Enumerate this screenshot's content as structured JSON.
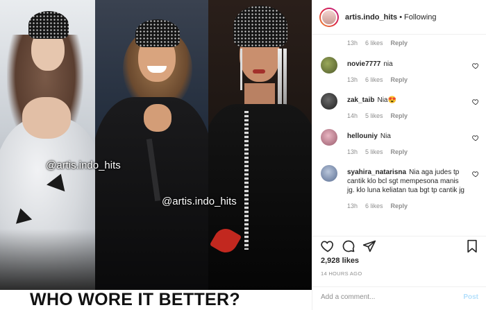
{
  "post": {
    "watermarks": [
      "@artis.indo_hits",
      "@artis.indo_hits"
    ],
    "caption": "WHO WORE IT BETTER?"
  },
  "header": {
    "username": "artis.indo_hits",
    "separator": "•",
    "follow_status": "Following"
  },
  "top_meta": {
    "time": "13h",
    "likes": "6 likes",
    "reply": "Reply"
  },
  "comments": [
    {
      "username": "novie7777",
      "text": "nia",
      "time": "13h",
      "likes": "6 likes",
      "reply": "Reply",
      "avatar_color": "#6b7a3e"
    },
    {
      "username": "zak_taib",
      "text": "Nia😍",
      "time": "14h",
      "likes": "5 likes",
      "reply": "Reply",
      "avatar_color": "#3c3c3c"
    },
    {
      "username": "hellouniy",
      "text": "Nia",
      "time": "13h",
      "likes": "5 likes",
      "reply": "Reply",
      "avatar_color": "#c7869a"
    },
    {
      "username": "syahira_natarisna",
      "text": "Nia aga judes tp cantik klo bcl sgt mempesona manis jg. klo luna keliatan tua bgt tp cantik jg",
      "time": "13h",
      "likes": "6 likes",
      "reply": "Reply",
      "avatar_color": "#8a9bb8"
    }
  ],
  "actions": {
    "like_icon": "heart-icon",
    "comment_icon": "comment-icon",
    "share_icon": "share-icon",
    "save_icon": "bookmark-icon",
    "likes": "2,928 likes",
    "timestamp": "14 HOURS AGO",
    "add_comment_placeholder": "Add a comment...",
    "post_label": "Post"
  },
  "colors": {
    "text": "#262626",
    "muted": "#8e8e8e",
    "post_disabled": "#b2dffc",
    "border": "#efefef"
  }
}
